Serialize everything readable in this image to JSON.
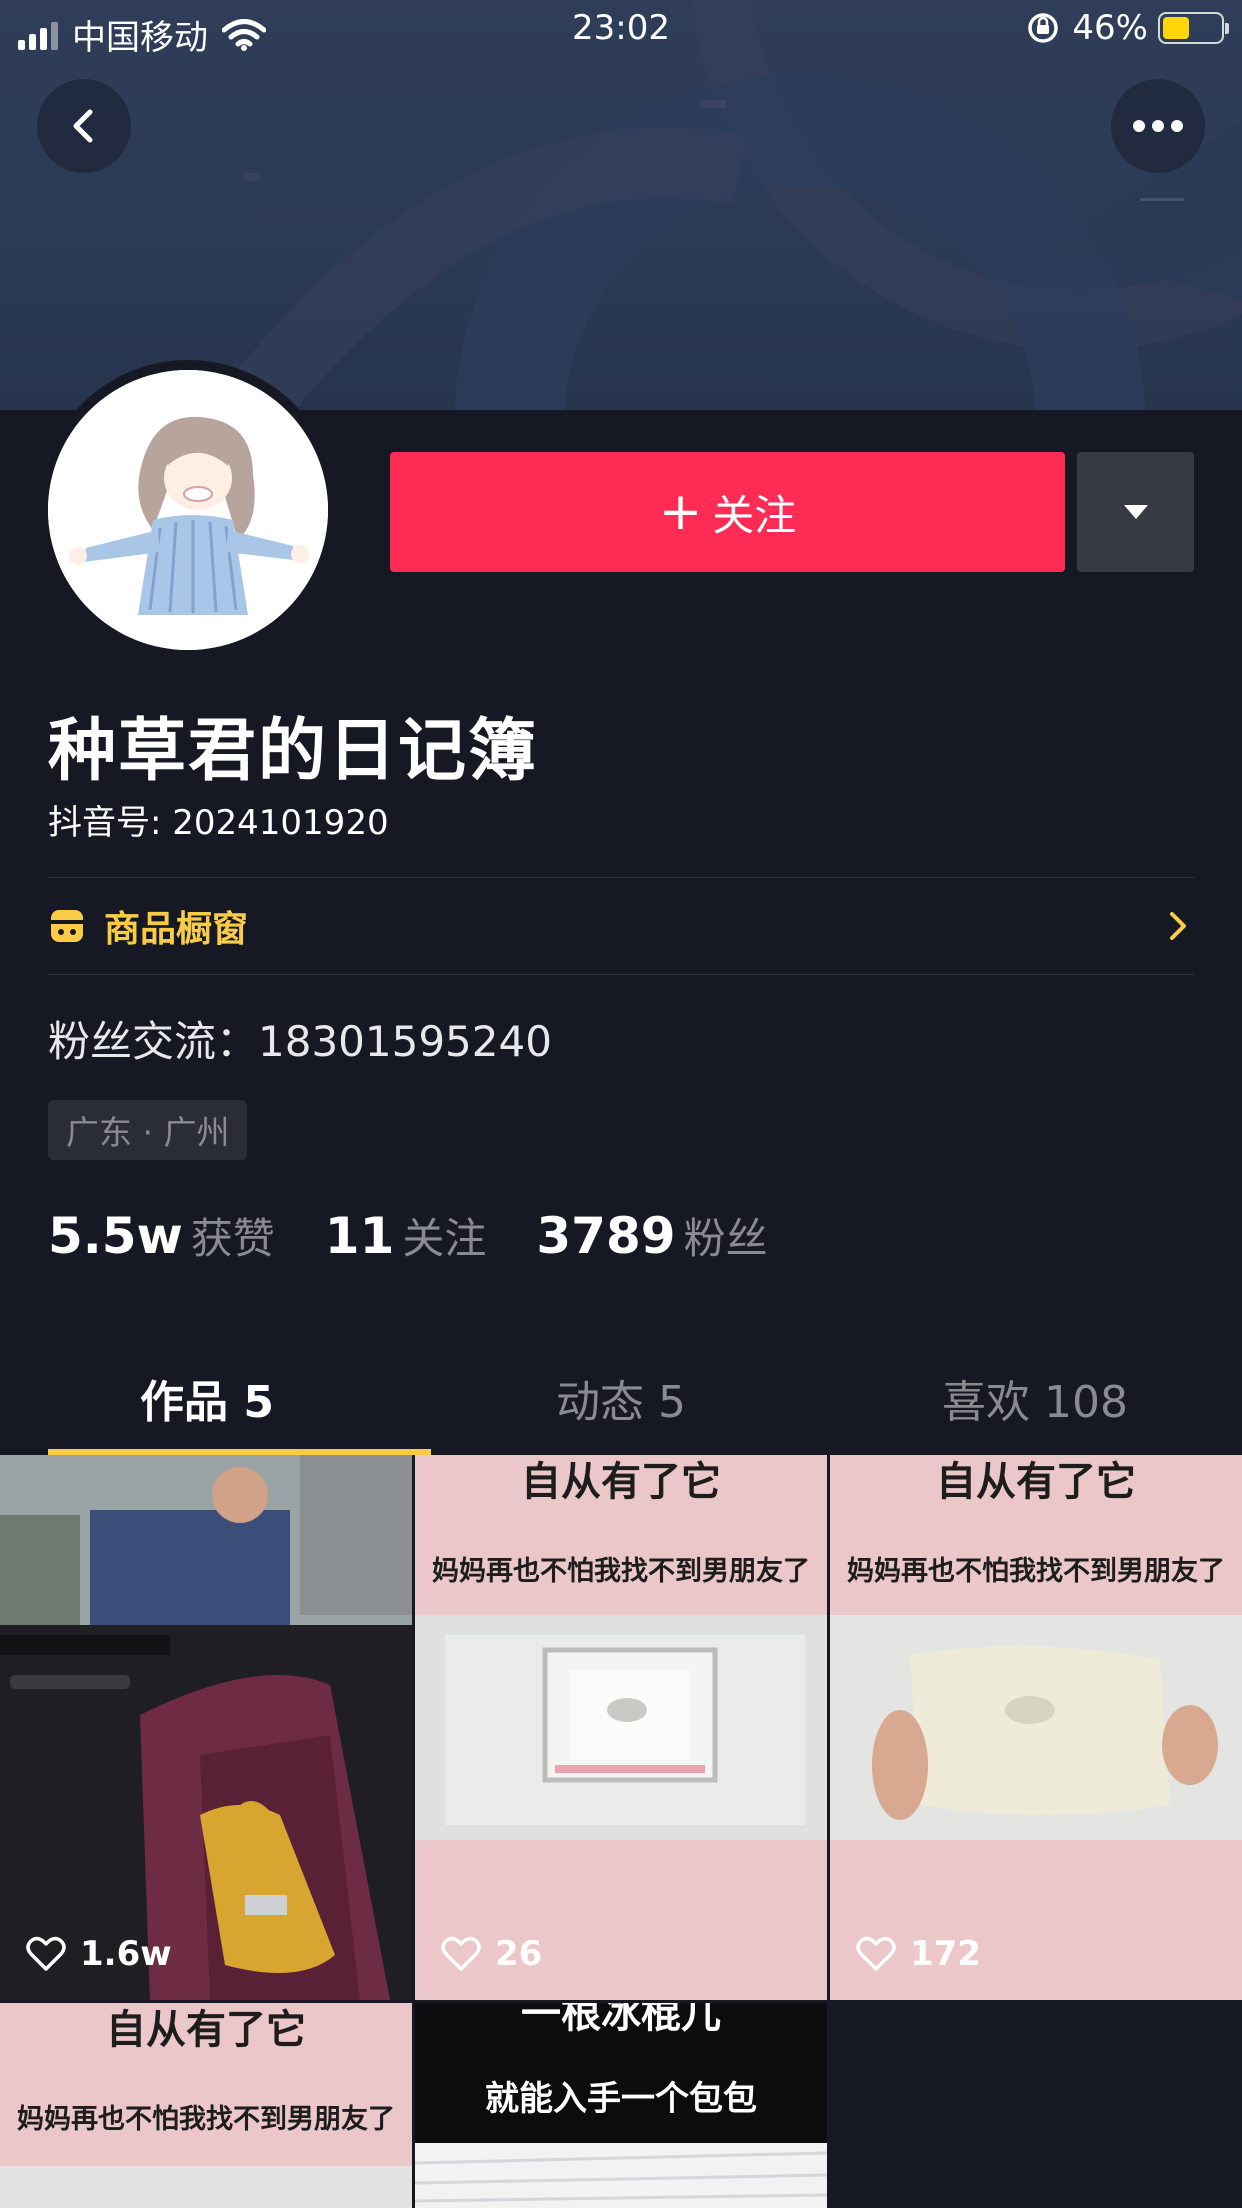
{
  "status_bar": {
    "carrier": "中国移动",
    "time": "23:02",
    "battery_percent": "46%",
    "battery_level": 0.46,
    "icons": [
      "signal-icon",
      "wifi-icon",
      "rotation-lock-icon",
      "battery-icon"
    ]
  },
  "header": {
    "back_icon": "chevron-left-icon",
    "more_icon": "ellipsis-icon"
  },
  "profile": {
    "follow_label": "关注",
    "follow_plus": "+",
    "nickname": "种草君的日记簿",
    "douyin_id": "抖音号: 2024101920",
    "shop_label": "商品橱窗",
    "bio": "粉丝交流：18301595240",
    "location": "广东 · 广州"
  },
  "stats": [
    {
      "value": "5.5w",
      "label": "获赞"
    },
    {
      "value": "11",
      "label": "关注"
    },
    {
      "value": "3789",
      "label": "粉丝"
    }
  ],
  "tabs": [
    {
      "label": "作品 5",
      "active": true
    },
    {
      "label": "动态 5",
      "active": false
    },
    {
      "label": "喜欢 108",
      "active": false
    }
  ],
  "videos": [
    {
      "likes": "1.6w"
    },
    {
      "title": "自从有了它",
      "subtitle": "妈妈再也不怕我找不到男朋友了",
      "likes": "26"
    },
    {
      "title": "自从有了它",
      "subtitle": "妈妈再也不怕我找不到男朋友了",
      "likes": "172"
    },
    {
      "title": "自从有了它",
      "subtitle": "妈妈再也不怕我找不到男朋友了"
    },
    {
      "title": "一根冰棍儿",
      "subtitle": "就能入手一个包包"
    }
  ],
  "colors": {
    "background": "#161823",
    "follow_button": "#fe2c55",
    "accent_yellow": "#facc46",
    "muted_text": "#8a8b91"
  }
}
